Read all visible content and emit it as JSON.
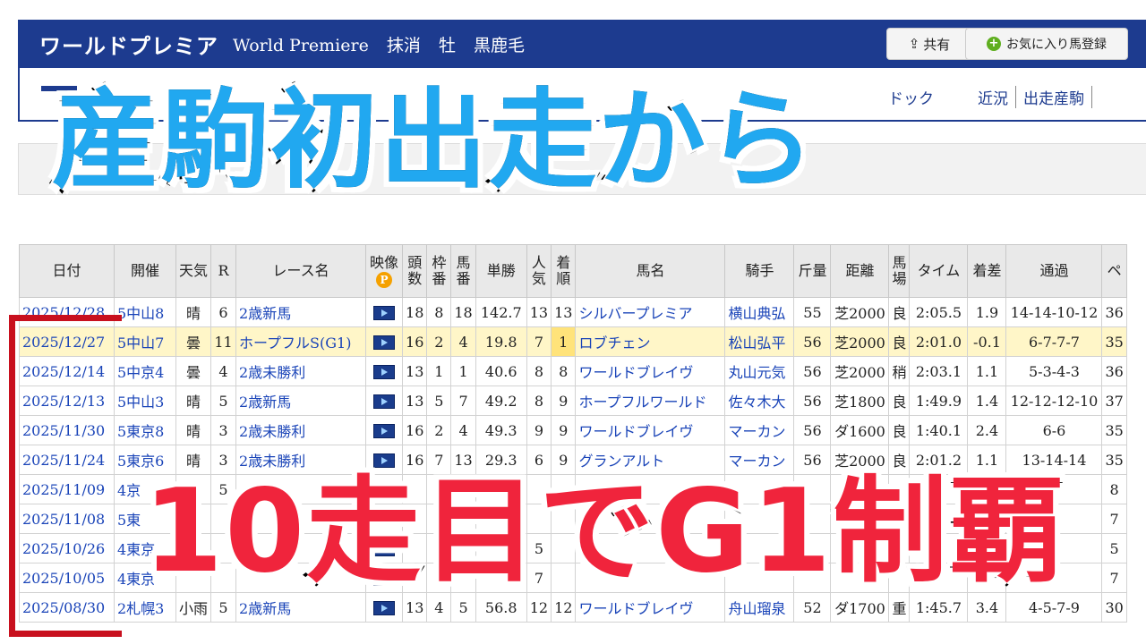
{
  "header": {
    "horse_name": "ワールドプレミア",
    "english_name": "World Premiere",
    "status": "抹消",
    "sex": "牡",
    "coat": "黒鹿毛",
    "share_label": "共有",
    "favorite_label": "お気に入り馬登録"
  },
  "subnav": {
    "video_label": "映像",
    "dock_label": "ドック",
    "tabs": [
      "近況",
      "出走産駒"
    ]
  },
  "overlay": {
    "top_caption": "産駒初出走から",
    "bottom_caption": "10走目でG1制覇"
  },
  "table": {
    "headers": {
      "date": "日付",
      "venue": "開催",
      "weather": "天気",
      "race_no": "R",
      "race_name": "レース名",
      "video": "映像",
      "heads": "頭数",
      "frame": "枠番",
      "horse_no": "馬番",
      "odds": "単勝",
      "pop": "人気",
      "finish": "着順",
      "horse": "馬名",
      "jockey": "騎手",
      "weight": "斤量",
      "distance": "距離",
      "track": "馬場",
      "time": "タイム",
      "margin": "着差",
      "passing": "通過"
    },
    "rows": [
      {
        "date": "2025/12/28",
        "venue": "5中山8",
        "weather": "晴",
        "r": "6",
        "race": "2歳新馬",
        "heads": "18",
        "frame": "8",
        "no": "18",
        "odds": "142.7",
        "pop": "13",
        "finish": "13",
        "horse": "シルバープレミア",
        "jockey": "横山典弘",
        "weight": "55",
        "distance": "芝2000",
        "track": "良",
        "time": "2:05.5",
        "margin": "1.9",
        "passing": "14-14-10-12",
        "extra": "36"
      },
      {
        "date": "2025/12/27",
        "venue": "5中山7",
        "weather": "曇",
        "r": "11",
        "race": "ホープフルS(G1)",
        "heads": "16",
        "frame": "2",
        "no": "4",
        "odds": "19.8",
        "pop": "7",
        "finish": "1",
        "horse": "ロブチェン",
        "jockey": "松山弘平",
        "weight": "56",
        "distance": "芝2000",
        "track": "良",
        "time": "2:01.0",
        "margin": "-0.1",
        "passing": "6-7-7-7",
        "extra": "35"
      },
      {
        "date": "2025/12/14",
        "venue": "5中京4",
        "weather": "曇",
        "r": "4",
        "race": "2歳未勝利",
        "heads": "13",
        "frame": "1",
        "no": "1",
        "odds": "40.6",
        "pop": "8",
        "finish": "8",
        "horse": "ワールドブレイヴ",
        "jockey": "丸山元気",
        "weight": "56",
        "distance": "芝2000",
        "track": "稍",
        "time": "2:03.1",
        "margin": "1.1",
        "passing": "5-3-4-3",
        "extra": "36"
      },
      {
        "date": "2025/12/13",
        "venue": "5中山3",
        "weather": "晴",
        "r": "5",
        "race": "2歳新馬",
        "heads": "13",
        "frame": "5",
        "no": "7",
        "odds": "49.2",
        "pop": "8",
        "finish": "9",
        "horse": "ホープフルワールド",
        "jockey": "佐々木大",
        "weight": "56",
        "distance": "芝1800",
        "track": "良",
        "time": "1:49.9",
        "margin": "1.4",
        "passing": "12-12-12-10",
        "extra": "37"
      },
      {
        "date": "2025/11/30",
        "venue": "5東京8",
        "weather": "晴",
        "r": "3",
        "race": "2歳未勝利",
        "heads": "16",
        "frame": "2",
        "no": "4",
        "odds": "49.3",
        "pop": "9",
        "finish": "9",
        "horse": "ワールドブレイヴ",
        "jockey": "マーカン",
        "weight": "56",
        "distance": "ダ1600",
        "track": "良",
        "time": "1:40.1",
        "margin": "2.4",
        "passing": "6-6",
        "extra": "35"
      },
      {
        "date": "2025/11/24",
        "venue": "5東京6",
        "weather": "晴",
        "r": "3",
        "race": "2歳未勝利",
        "heads": "16",
        "frame": "7",
        "no": "13",
        "odds": "29.3",
        "pop": "6",
        "finish": "9",
        "horse": "グランアルト",
        "jockey": "マーカン",
        "weight": "56",
        "distance": "芝2000",
        "track": "良",
        "time": "2:01.2",
        "margin": "1.1",
        "passing": "13-14-14",
        "extra": "35"
      },
      {
        "date": "2025/11/09",
        "venue": "4京",
        "weather": "",
        "r": "5",
        "race": "",
        "heads": "",
        "frame": "",
        "no": "",
        "odds": "",
        "pop": "",
        "finish": "",
        "horse": "",
        "jockey": "",
        "weight": "",
        "distance": "",
        "track": "",
        "time": "",
        "margin": "",
        "passing": "",
        "extra": "8"
      },
      {
        "date": "2025/11/08",
        "venue": "5東",
        "weather": "",
        "r": "",
        "race": "",
        "heads": "",
        "frame": "",
        "no": "",
        "odds": "",
        "pop": "",
        "finish": "",
        "horse": "",
        "jockey": "",
        "weight": "",
        "distance": "",
        "track": "",
        "time": "",
        "margin": "",
        "passing": "",
        "extra": "7"
      },
      {
        "date": "2025/10/26",
        "venue": "4東京",
        "weather": "",
        "r": "",
        "race": "",
        "heads": "",
        "frame": "",
        "no": "",
        "odds": "",
        "pop": "5",
        "finish": "",
        "horse": "",
        "jockey": "",
        "weight": "",
        "distance": "",
        "track": "",
        "time": "",
        "margin": "",
        "passing": "",
        "extra": "5"
      },
      {
        "date": "2025/10/05",
        "venue": "4東京",
        "weather": "",
        "r": "",
        "race": "",
        "heads": "",
        "frame": "",
        "no": "",
        "odds": "",
        "pop": "7",
        "finish": "",
        "horse": "",
        "jockey": "",
        "weight": "",
        "distance": "",
        "track": "",
        "time": "",
        "margin": "",
        "passing": "",
        "extra": "7"
      },
      {
        "date": "2025/08/30",
        "venue": "2札幌3",
        "weather": "小雨",
        "r": "5",
        "race": "2歳新馬",
        "heads": "13",
        "frame": "4",
        "no": "5",
        "odds": "56.8",
        "pop": "12",
        "finish": "12",
        "horse": "ワールドブレイヴ",
        "jockey": "舟山瑠泉",
        "weight": "52",
        "distance": "ダ1700",
        "track": "重",
        "time": "1:45.7",
        "margin": "3.4",
        "passing": "4-5-7-9",
        "extra": "30"
      }
    ]
  }
}
